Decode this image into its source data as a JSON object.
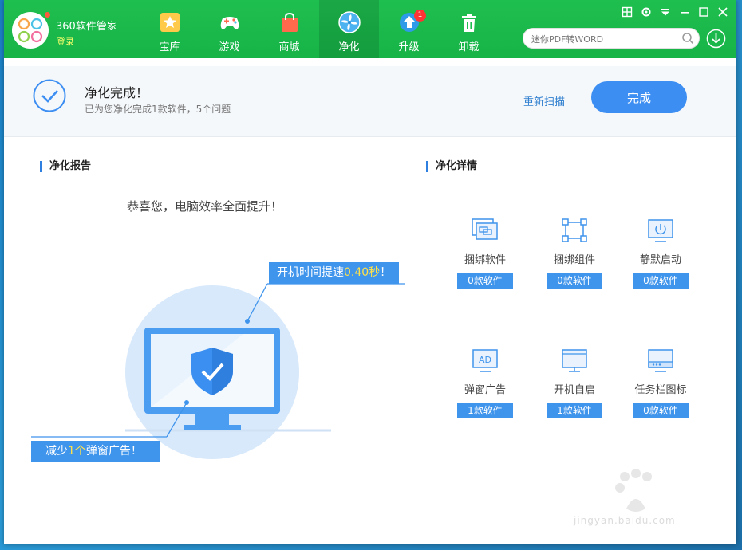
{
  "app": {
    "brand": "360软件管家",
    "login": "登录"
  },
  "nav": [
    {
      "label": "宝库",
      "icon": "treasure-star-icon"
    },
    {
      "label": "游戏",
      "icon": "gamepad-icon"
    },
    {
      "label": "商城",
      "icon": "shopping-bag-icon"
    },
    {
      "label": "净化",
      "icon": "purify-fan-icon",
      "active": true
    },
    {
      "label": "升级",
      "icon": "upgrade-arrow-icon",
      "badge": "1"
    },
    {
      "label": "卸载",
      "icon": "trash-icon"
    }
  ],
  "search": {
    "placeholder": "迷你PDF转WORD"
  },
  "status": {
    "title": "净化完成！",
    "subtitle": "已为您净化完成1款软件，5个问题",
    "rescan": "重新扫描",
    "done": "完成"
  },
  "report": {
    "title": "净化报告",
    "congrats": "恭喜您，电脑效率全面提升！",
    "boot_prefix": "开机时间提速",
    "boot_value": "0.40秒",
    "boot_suffix": "！",
    "ads_prefix": "减少",
    "ads_value": "1个",
    "ads_suffix": "弹窗广告！"
  },
  "details": {
    "title": "净化详情",
    "items": [
      {
        "label": "捆绑软件",
        "count": "0款软件",
        "icon": "bundled-software-icon"
      },
      {
        "label": "捆绑组件",
        "count": "0款软件",
        "icon": "bundled-component-icon"
      },
      {
        "label": "静默启动",
        "count": "0款软件",
        "icon": "silent-start-icon"
      },
      {
        "label": "弹窗广告",
        "count": "1款软件",
        "icon": "popup-ad-icon",
        "icon_text": "AD"
      },
      {
        "label": "开机自启",
        "count": "1款软件",
        "icon": "autostart-icon"
      },
      {
        "label": "任务栏图标",
        "count": "0款软件",
        "icon": "taskbar-icon"
      }
    ]
  },
  "watermark": {
    "text": "jingyan.baidu.com"
  },
  "colors": {
    "header_green": "#1fbf4f",
    "accent_blue": "#3c8ef2",
    "highlight_yellow": "#ffe24a"
  }
}
